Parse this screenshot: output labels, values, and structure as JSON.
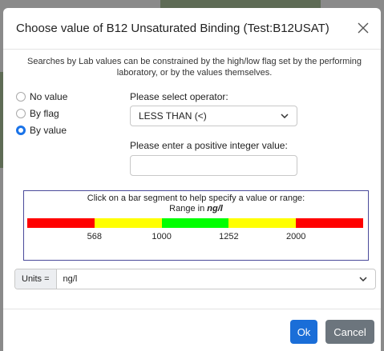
{
  "dialog": {
    "title": "Choose value of B12 Unsaturated Binding (Test:B12USAT)",
    "close_icon": "close-icon"
  },
  "intro_text": "Searches by Lab values can be constrained by the high/low flag set by the performing laboratory, or by the values themselves.",
  "mode_options": [
    {
      "label": "No value",
      "checked": false
    },
    {
      "label": "By flag",
      "checked": false
    },
    {
      "label": "By value",
      "checked": true
    }
  ],
  "operator": {
    "label": "Please select operator:",
    "selected": "LESS THAN (<)",
    "chevron_icon": "chevron-down-icon"
  },
  "value_field": {
    "label": "Please enter a positive integer value:",
    "value": "",
    "placeholder": ""
  },
  "range_helper": {
    "hint": "Click on a bar segment to help specify a value or range:",
    "range_prefix": "Range in ",
    "range_unit": "ng/l",
    "segments": [
      {
        "color": "#ff0000",
        "from_fraction": 0.0,
        "to_fraction": 0.2
      },
      {
        "color": "#ffff00",
        "from_fraction": 0.2,
        "to_fraction": 0.4
      },
      {
        "color": "#00ff00",
        "from_fraction": 0.4,
        "to_fraction": 0.6
      },
      {
        "color": "#ffff00",
        "from_fraction": 0.6,
        "to_fraction": 0.8
      },
      {
        "color": "#ff0000",
        "from_fraction": 0.8,
        "to_fraction": 1.0
      }
    ],
    "ticks": [
      {
        "label": "568",
        "at_fraction": 0.2
      },
      {
        "label": "1000",
        "at_fraction": 0.4
      },
      {
        "label": "1252",
        "at_fraction": 0.6
      },
      {
        "label": "2000",
        "at_fraction": 0.8
      }
    ]
  },
  "units": {
    "label": "Units =",
    "selected": "ng/l",
    "chevron_icon": "chevron-down-icon"
  },
  "footer": {
    "ok_label": "Ok",
    "cancel_label": "Cancel"
  },
  "colors": {
    "primary": "#1a6ed8",
    "secondary": "#6c757d",
    "range_border": "#4a4a9a"
  }
}
